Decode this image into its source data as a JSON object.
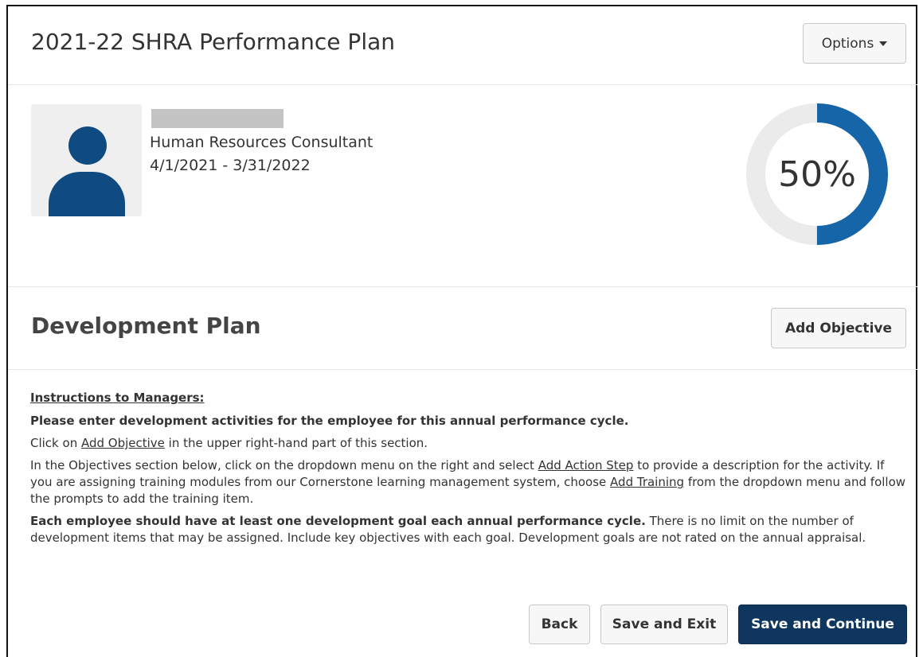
{
  "header": {
    "title": "2021-22 SHRA Performance Plan",
    "options_label": "Options"
  },
  "profile": {
    "job_title": "Human Resources Consultant",
    "date_range": "4/1/2021 - 3/31/2022",
    "progress_label": "50%",
    "progress_fraction": 0.5
  },
  "development": {
    "title": "Development Plan",
    "add_objective_label": "Add Objective"
  },
  "instructions": {
    "heading": "Instructions to Managers:",
    "intro": "Please enter development activities for the employee for this annual performance cycle.",
    "p1_pre": "Click on ",
    "p1_link": "Add Objective",
    "p1_post": " in the upper right-hand part of this section.",
    "p2_pre": "In the Objectives section below, click on the dropdown menu on the right and select ",
    "p2_link1": "Add Action Step",
    "p2_mid": " to provide a description for the activity. If you are assigning training modules from our Cornerstone learning management system, choose ",
    "p2_link2": "Add Training",
    "p2_post": " from the dropdown menu and follow the prompts to add the training item.",
    "p3_bold": "Each employee should have at least one development goal each annual performance cycle.",
    "p3_rest": " There is no limit on the number of development items that may be assigned. Include key objectives with each goal. Development goals are not rated on the annual appraisal."
  },
  "footer": {
    "back_label": "Back",
    "save_exit_label": "Save and Exit",
    "save_continue_label": "Save and Continue"
  },
  "colors": {
    "progress_fill": "#1565a8",
    "progress_track": "#ebebeb",
    "primary_button": "#0f365e",
    "avatar_fill": "#0f4b80"
  }
}
